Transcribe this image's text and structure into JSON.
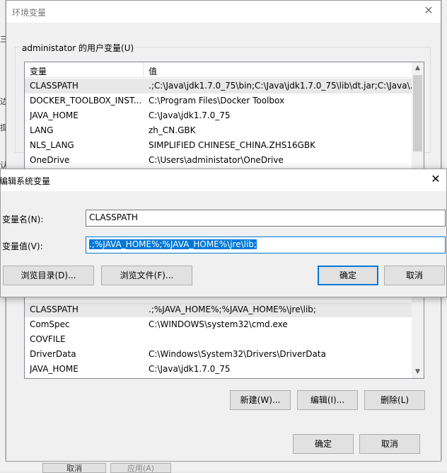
{
  "env_window": {
    "title": "环境变量",
    "user_vars_label": "administator 的用户变量(U)",
    "columns": [
      "变量",
      "值"
    ],
    "user_vars": [
      {
        "name": "CLASSPATH",
        "value": ".;C:\\Java\\jdk1.7.0_75\\bin;C:\\Java\\jdk1.7.0_75\\lib\\dt.jar;C:\\Java\\..."
      },
      {
        "name": "DOCKER_TOOLBOX_INST...",
        "value": "C:\\Program Files\\Docker Toolbox"
      },
      {
        "name": "JAVA_HOME",
        "value": "C:\\Java\\jdk1.7.0_75"
      },
      {
        "name": "LANG",
        "value": "zh_CN.GBK"
      },
      {
        "name": "NLS_LANG",
        "value": "SIMPLIFIED CHINESE_CHINA.ZHS16GBK"
      },
      {
        "name": "OneDrive",
        "value": "C:\\Users\\administator\\OneDrive"
      }
    ],
    "sys_vars": [
      {
        "name": "CLASSPATH",
        "value": ".;%JAVA_HOME%;%JAVA_HOME%\\jre\\lib;"
      },
      {
        "name": "ComSpec",
        "value": "C:\\WINDOWS\\system32\\cmd.exe"
      },
      {
        "name": "COVFILE",
        "value": ""
      },
      {
        "name": "DriverData",
        "value": "C:\\Windows\\System32\\Drivers\\DriverData"
      },
      {
        "name": "JAVA_HOME",
        "value": "C:\\Java\\jdk1.7.0_75"
      }
    ],
    "sys_buttons": {
      "new": "新建(W)...",
      "edit": "编辑(I)...",
      "delete": "删除(L)"
    },
    "ok": "确定",
    "cancel": "取消"
  },
  "edit_dialog": {
    "title": "编辑系统变量",
    "name_label": "变量名(N):",
    "name_value": "CLASSPATH",
    "value_label": "变量值(V):",
    "value_value": ".;%JAVA_HOME%;%JAVA_HOME%\\jre\\lib;",
    "browse_dir": "浏览目录(D)...",
    "browse_file": "浏览文件(F)...",
    "ok": "确定",
    "cancel": "取消"
  },
  "background": {
    "left_chars": [
      "三",
      "边",
      "提",
      "认"
    ],
    "cancel": "取消",
    "apply": "应用(A)"
  },
  "colors": {
    "accent": "#0078d7",
    "dialog_bg": "#f0f0f0"
  }
}
